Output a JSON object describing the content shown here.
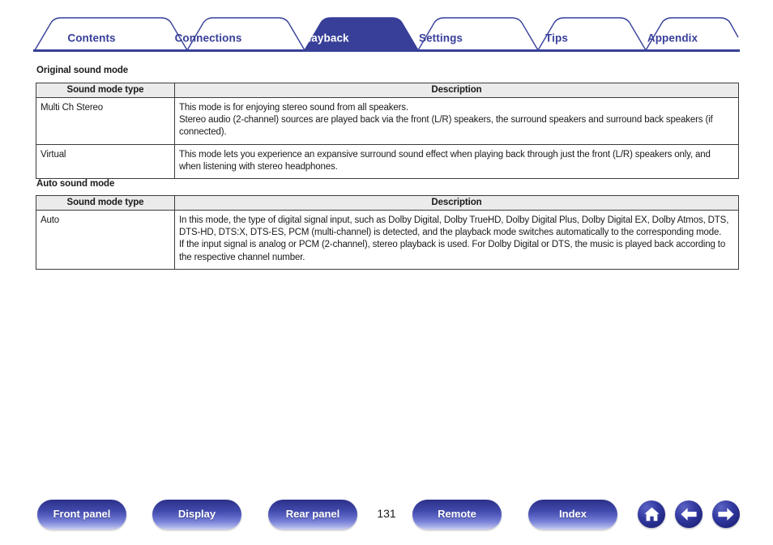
{
  "tabs": [
    {
      "label": "Contents",
      "active": false
    },
    {
      "label": "Connections",
      "active": false
    },
    {
      "label": "Playback",
      "active": true
    },
    {
      "label": "Settings",
      "active": false
    },
    {
      "label": "Tips",
      "active": false
    },
    {
      "label": "Appendix",
      "active": false
    }
  ],
  "sections": [
    {
      "heading": "Original sound mode",
      "columns": [
        "Sound mode type",
        "Description"
      ],
      "rows": [
        {
          "type": "Multi Ch Stereo",
          "description": [
            "This mode is for enjoying stereo sound from all speakers.",
            "Stereo audio (2-channel) sources are played back via the front (L/R) speakers, the surround speakers and surround back speakers (if connected)."
          ]
        },
        {
          "type": "Virtual",
          "description": [
            "This mode lets you experience an expansive surround sound effect when playing back through just the front (L/R) speakers only, and when listening with stereo headphones."
          ]
        }
      ]
    },
    {
      "heading": "Auto sound mode",
      "columns": [
        "Sound mode type",
        "Description"
      ],
      "rows": [
        {
          "type": "Auto",
          "description": [
            "In this mode, the type of digital signal input, such as Dolby Digital, Dolby TrueHD, Dolby Digital Plus, Dolby Digital EX, Dolby Atmos, DTS, DTS-HD, DTS:X, DTS-ES, PCM (multi-channel) is detected, and the playback mode switches automatically to the corresponding mode.",
            "If the input signal is analog or PCM (2-channel), stereo playback is used. For Dolby Digital or DTS, the music is played back according to the respective channel number."
          ]
        }
      ]
    }
  ],
  "bottom_nav": {
    "buttons": [
      {
        "label": "Front panel"
      },
      {
        "label": "Display"
      },
      {
        "label": "Rear panel"
      },
      {
        "label": "Remote"
      },
      {
        "label": "Index"
      }
    ],
    "page_number": "131",
    "icons": [
      {
        "name": "home-icon"
      },
      {
        "name": "arrow-left-icon"
      },
      {
        "name": "arrow-right-icon"
      }
    ]
  },
  "colors": {
    "brand_blue": "#373f99",
    "tab_active_bg": "#373f99",
    "table_header_bg": "#ebebeb",
    "table_border": "#3c3c3c"
  }
}
